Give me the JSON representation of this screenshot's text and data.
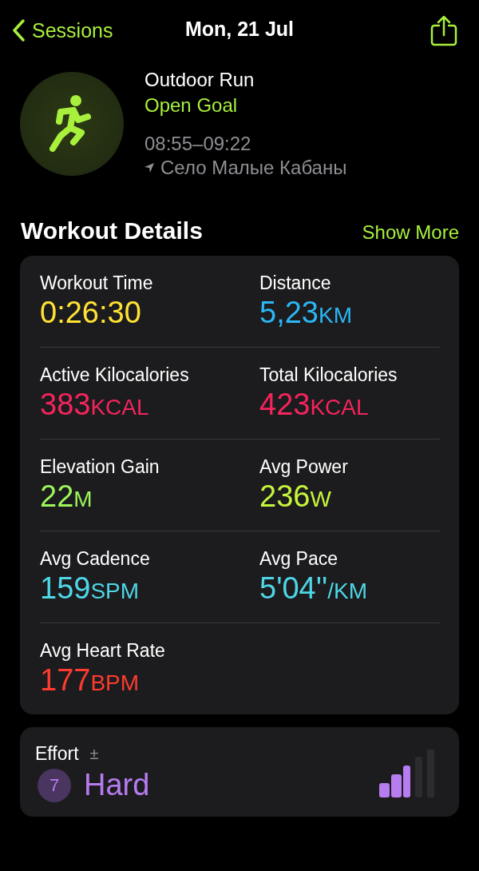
{
  "nav": {
    "back": "Sessions",
    "title": "Mon, 21 Jul"
  },
  "workout": {
    "name": "Outdoor Run",
    "goal": "Open Goal",
    "time": "08:55–09:22",
    "location": "Село Малые Кабаны"
  },
  "details": {
    "title": "Workout Details",
    "action": "Show More",
    "metrics": [
      {
        "label": "Workout Time",
        "value": "0:26:30",
        "color": "#ffe234"
      },
      {
        "label": "Distance",
        "value": "5,23",
        "unit": "KM",
        "color": "#2bb6f5"
      },
      {
        "label": "Active Kilocalories",
        "value": "383",
        "unit": "KCAL",
        "color": "#f5245c"
      },
      {
        "label": "Total Kilocalories",
        "value": "423",
        "unit": "KCAL",
        "color": "#f5245c"
      },
      {
        "label": "Elevation Gain",
        "value": "22",
        "unit": "M",
        "color": "#9cf55a"
      },
      {
        "label": "Avg Power",
        "value": "236",
        "unit": "W",
        "color": "#c6f53c"
      },
      {
        "label": "Avg Cadence",
        "value": "159",
        "unit": "SPM",
        "color": "#4ed6e6"
      },
      {
        "label": "Avg Pace",
        "value": "5'04''",
        "unit": "/KM",
        "color": "#4ed6e6"
      },
      {
        "label": "Avg Heart Rate",
        "value": "177",
        "unit": "BPM",
        "color": "#ff3b30"
      }
    ]
  },
  "effort": {
    "title": "Effort",
    "adjust": "±",
    "score": "7",
    "rating": "Hard",
    "level": 0.6
  }
}
